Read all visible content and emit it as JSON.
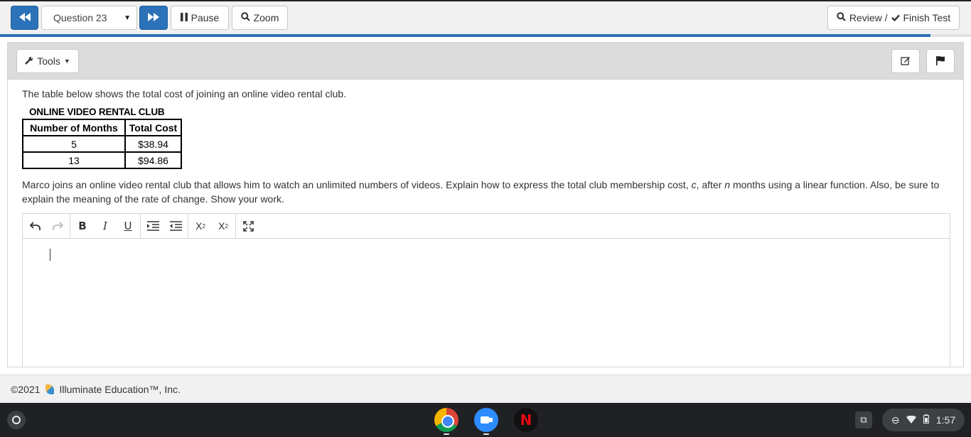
{
  "nav": {
    "question_select": "Question 23",
    "pause_label": "Pause",
    "zoom_label": "Zoom",
    "review_label": "Review /",
    "finish_label": "Finish Test",
    "progress_fraction": 0.958
  },
  "panel": {
    "tools_label": "Tools"
  },
  "question": {
    "intro": "The table below shows the total cost of joining an online video rental club.",
    "table_title": "ONLINE VIDEO RENTAL CLUB",
    "table_headers": [
      "Number of Months",
      "Total Cost"
    ],
    "table_rows": [
      [
        "5",
        "$38.94"
      ],
      [
        "13",
        "$94.86"
      ]
    ],
    "prompt_part1": "Marco joins an online video rental club that allows him to watch an unlimited numbers of videos. Explain how to express the total club membership cost, ",
    "var_c": "c",
    "prompt_part2": ", after ",
    "var_n": "n",
    "prompt_part3": " months using a linear function. Also, be sure to explain the meaning of the rate of change. Show your work."
  },
  "editor": {
    "toolbar": [
      "undo-icon",
      "redo-icon",
      "bold-icon",
      "italic-icon",
      "underline-icon",
      "indent-icon",
      "outdent-icon",
      "subscript-icon",
      "superscript-icon",
      "fullscreen-icon"
    ]
  },
  "footer": {
    "copyright": "©2021",
    "company": "Illuminate Education™, Inc."
  },
  "taskbar": {
    "time": "1:57"
  },
  "colors": {
    "accent": "#2b72b8"
  }
}
